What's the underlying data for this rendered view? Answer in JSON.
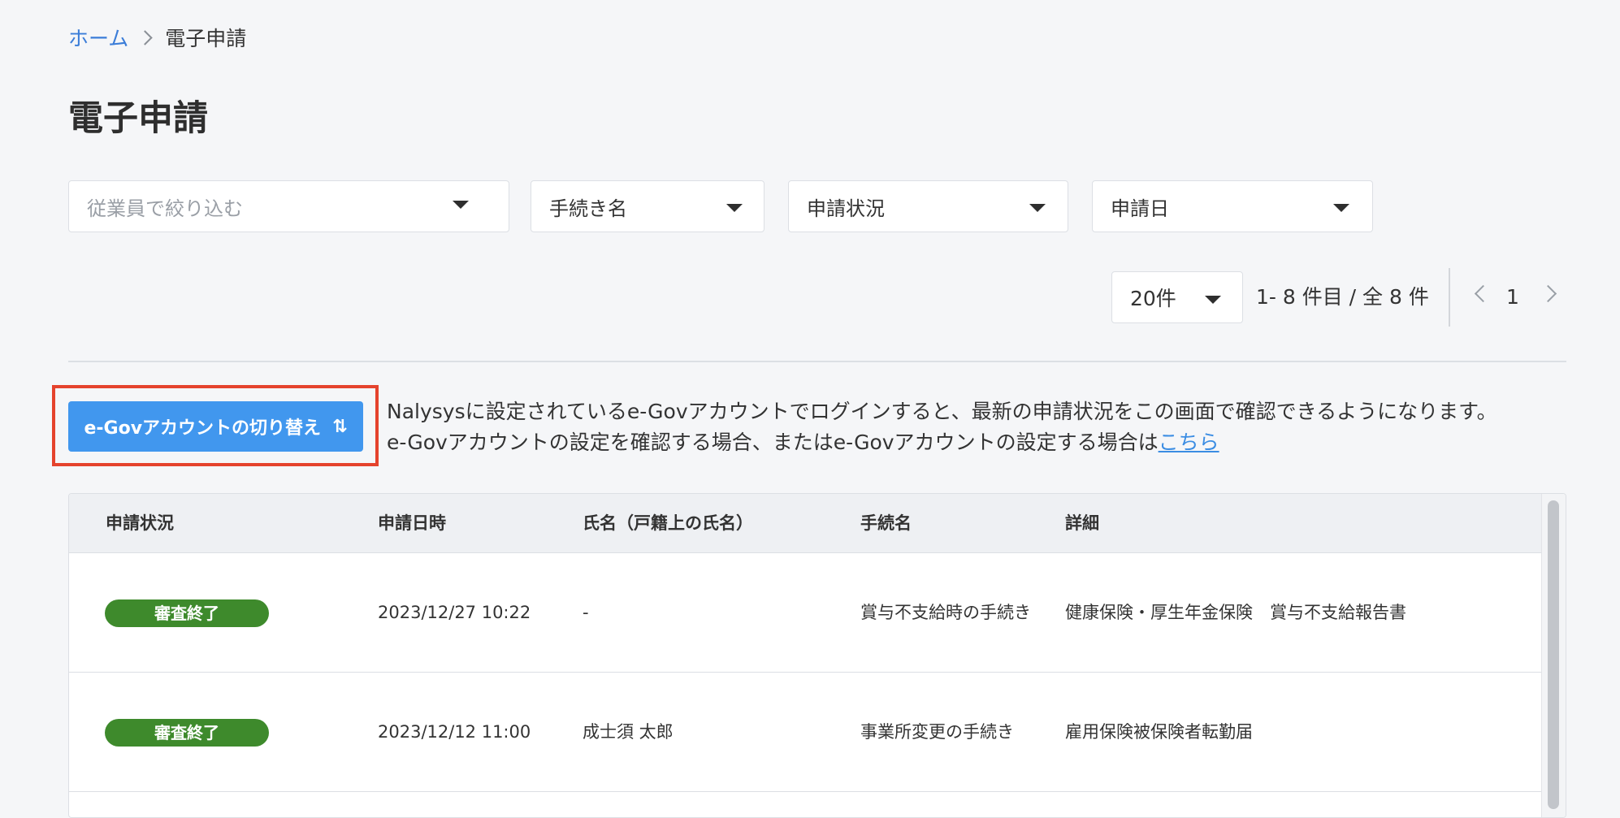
{
  "breadcrumb": {
    "home": "ホーム",
    "current": "電子申請"
  },
  "page": {
    "title": "電子申請"
  },
  "filters": {
    "employee_placeholder": "従業員で絞り込む",
    "procedure_label": "手続き名",
    "status_label": "申請状況",
    "date_label": "申請日"
  },
  "pagination": {
    "page_size": "20件",
    "range_text": "1- 8 件目 /  全 8 件",
    "current_page": "1"
  },
  "egov": {
    "button_label": "e-Govアカウントの切り替え",
    "button_icon": "⇅",
    "notice_line1": "Nalysysに設定されているe-Govアカウントでログインすると、最新の申請状況をこの画面で確認できるようになります。",
    "notice_line2": "e-Govアカウントの設定を確認する場合、またはe-Govアカウントの設定する場合は",
    "notice_link": "こちら"
  },
  "table": {
    "headers": {
      "status": "申請状況",
      "datetime": "申請日時",
      "name": "氏名（戸籍上の氏名）",
      "procedure": "手続名",
      "detail": "詳細"
    },
    "rows": [
      {
        "status": "審査終了",
        "datetime": "2023/12/27 10:22",
        "name": "-",
        "procedure": "賞与不支給時の手続き",
        "detail": "健康保険・厚生年金保険　賞与不支給報告書"
      },
      {
        "status": "審査終了",
        "datetime": "2023/12/12 11:00",
        "name": "成士須 太郎",
        "procedure": "事業所変更の手続き",
        "detail": "雇用保険被保険者転勤届"
      }
    ]
  },
  "colors": {
    "background": "#f5f6f8",
    "link": "#3b7dd8",
    "primary_button": "#4197ee",
    "status_badge": "#3e8a2c",
    "highlight_border": "#e5432d"
  },
  "icons": {
    "breadcrumb_separator": "chevron-right-icon",
    "dropdown": "caret-down-icon",
    "pager_prev": "chevron-left-icon",
    "pager_next": "chevron-right-icon",
    "switch": "swap-vertical-icon"
  }
}
